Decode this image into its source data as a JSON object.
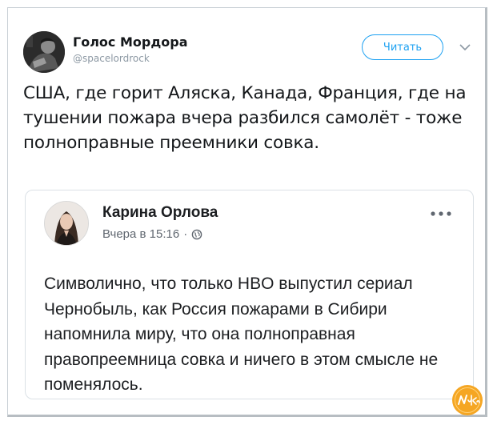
{
  "tweet": {
    "author_name": "Голос Мордора",
    "author_handle": "@spacelordrock",
    "follow_label": "Читать",
    "text": "США, где горит Аляска, Канада, Франция, где на тушении пожара вчера разбился самолёт - тоже полноправные преемники совка."
  },
  "quoted_post": {
    "author_name": "Карина Орлова",
    "timestamp": "Вчера в 15:16",
    "separator": "·",
    "text": "Символично, что только HBO выпустил сериал Чернобыль, как Россия пожарами в Сибири напомнила миру, что она полноправная правопреемница совка и ничего в этом смысле не поменялось."
  },
  "watermark": {
    "text": "Nyka"
  },
  "icons": {
    "dropdown": "chevron-down-icon",
    "privacy": "globe-icon",
    "more": "more-options-icon"
  },
  "colors": {
    "accent": "#1da1f2",
    "text": "#14171a",
    "muted": "#8c98a3",
    "watermark": "#f5a623"
  }
}
